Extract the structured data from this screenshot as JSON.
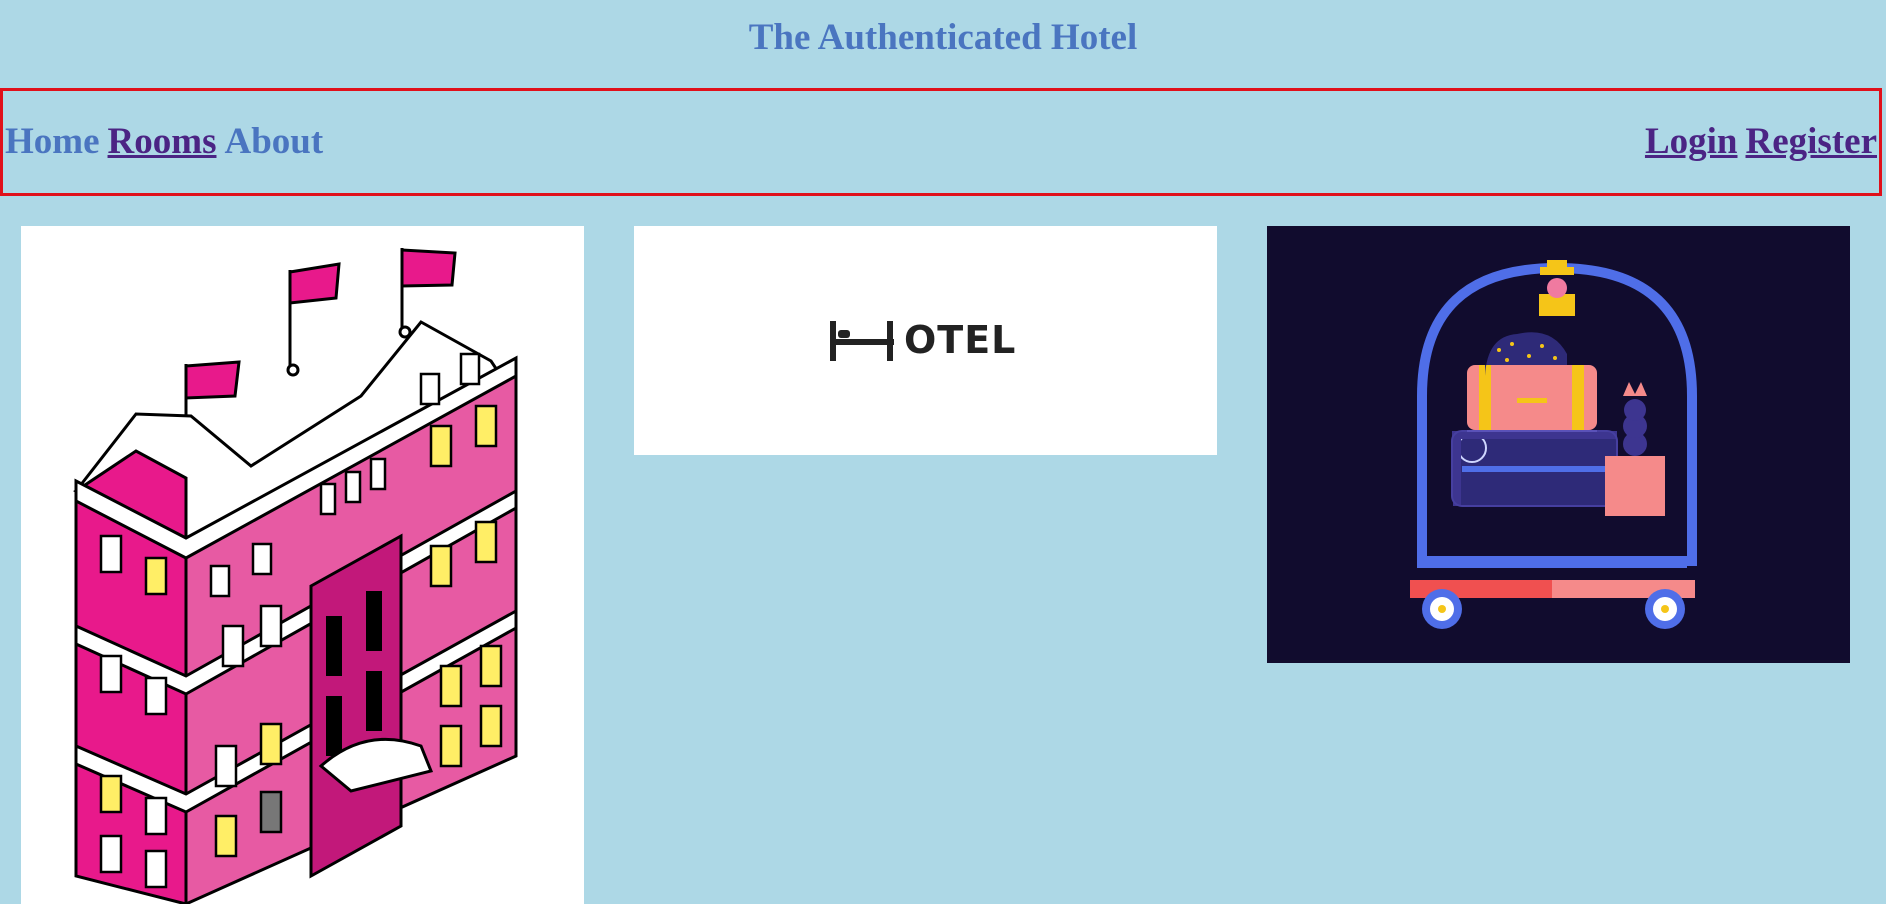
{
  "header": {
    "title": "The Authenticated Hotel"
  },
  "nav": {
    "left": [
      {
        "label": "Home",
        "style": "plain"
      },
      {
        "label": "Rooms",
        "style": "visited"
      },
      {
        "label": "About",
        "style": "plain"
      }
    ],
    "right": [
      {
        "label": "Login",
        "style": "visited"
      },
      {
        "label": "Register",
        "style": "visited"
      }
    ]
  },
  "gallery": {
    "logo_text": "OTEL"
  },
  "colors": {
    "background": "#add8e6",
    "title": "#4a75c0",
    "link_visited": "#4b2484",
    "nav_border": "#e0101a"
  }
}
